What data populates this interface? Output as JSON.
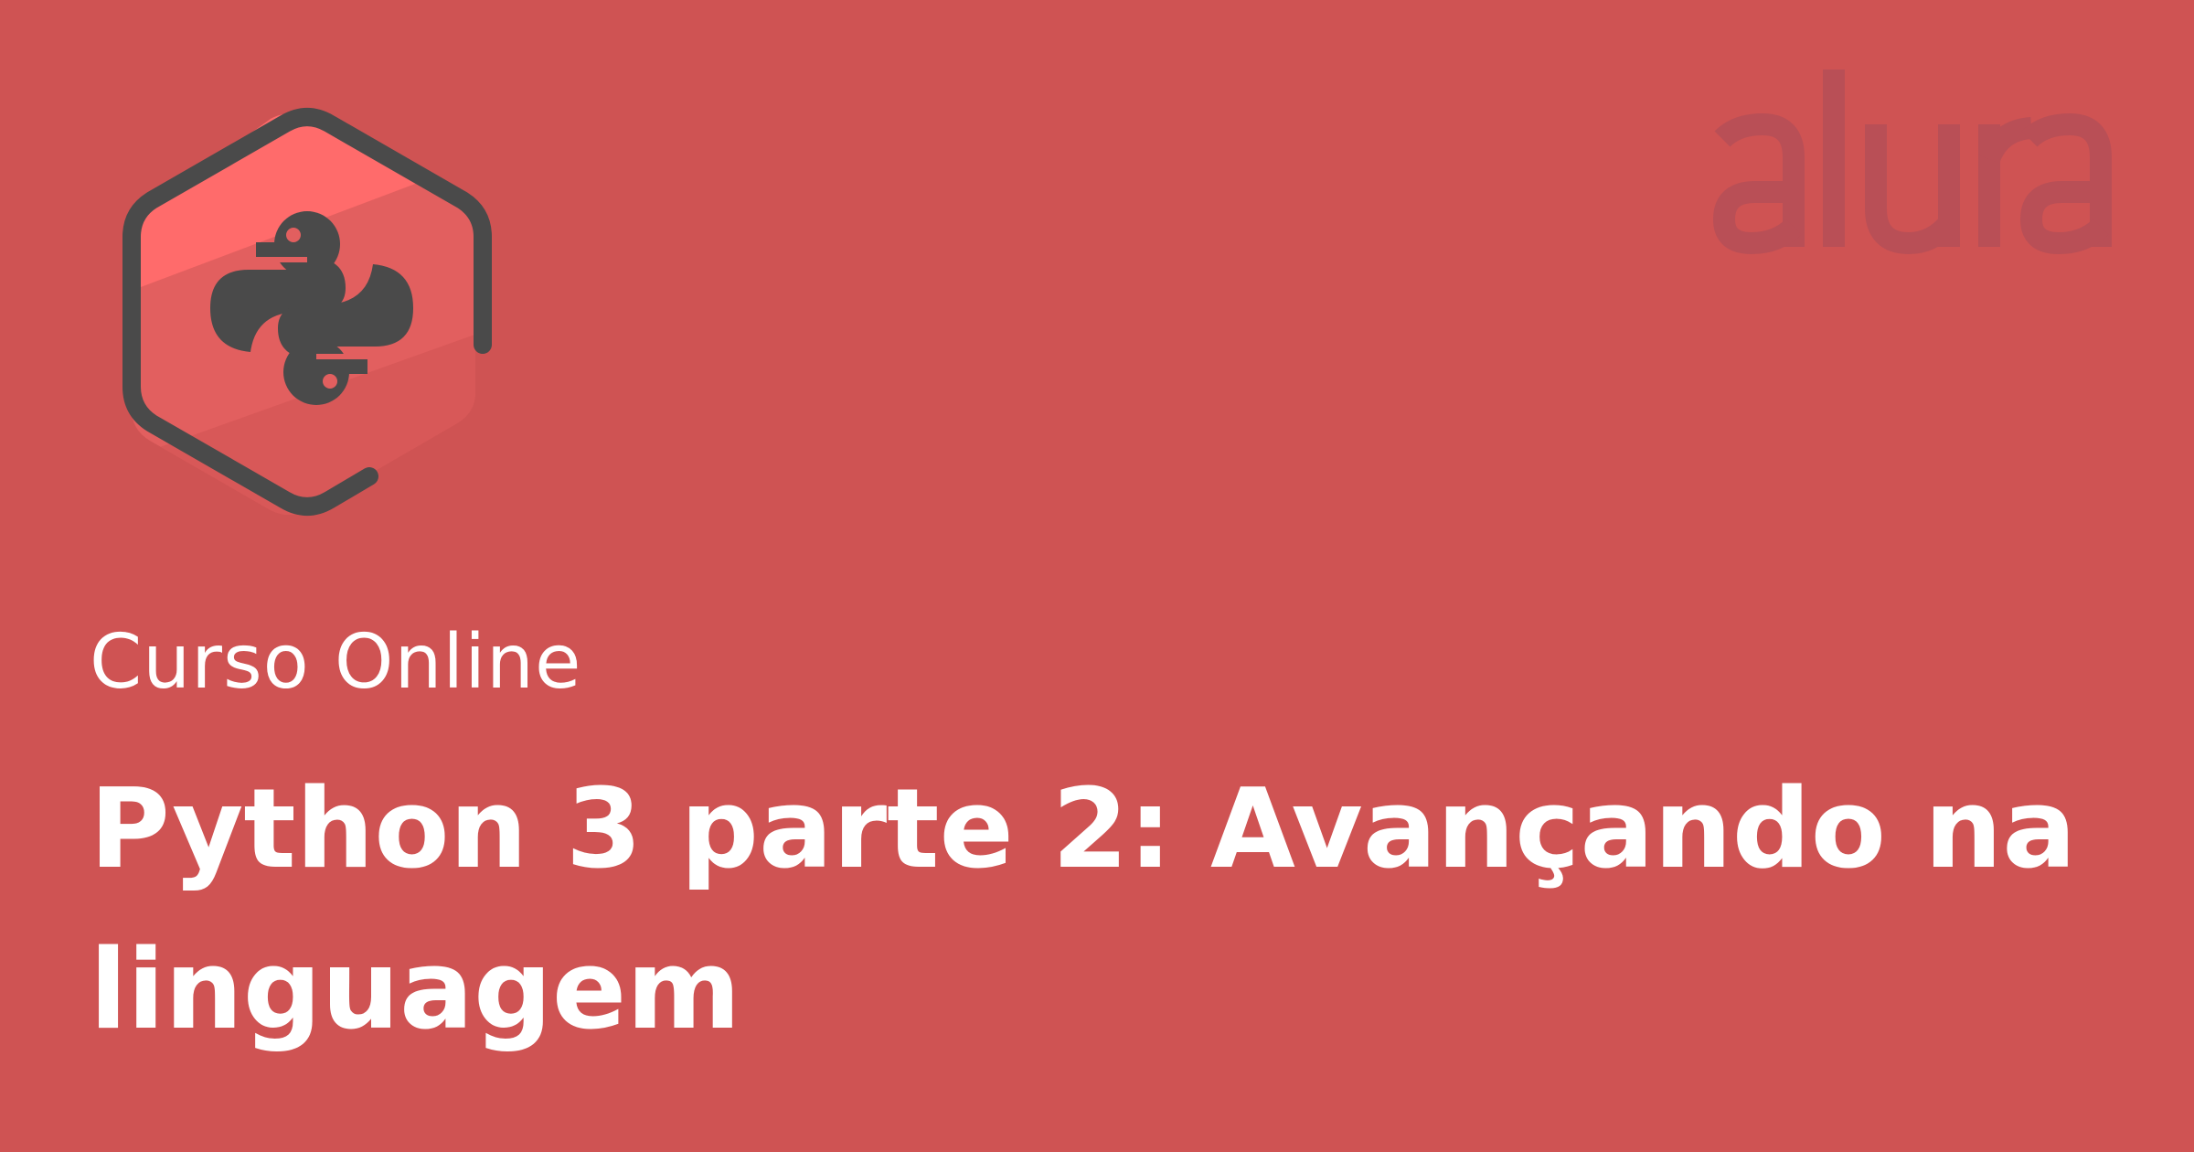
{
  "banner": {
    "subtitle": "Curso Online",
    "title": "Python 3 parte 2: Avançando na linguagem",
    "brand_name": "alura"
  },
  "colors": {
    "background": "#CF5353",
    "hexagon_fill": "#E25F5F",
    "hexagon_highlight": "#FF6B6B",
    "hexagon_stroke": "#4A4A4A",
    "python_icon": "#4A4A4A",
    "brand_logo": "#B94F56",
    "text": "#FFFFFF"
  },
  "icons": {
    "course_icon": "python-hexagon-icon",
    "brand_logo": "alura-logo"
  }
}
